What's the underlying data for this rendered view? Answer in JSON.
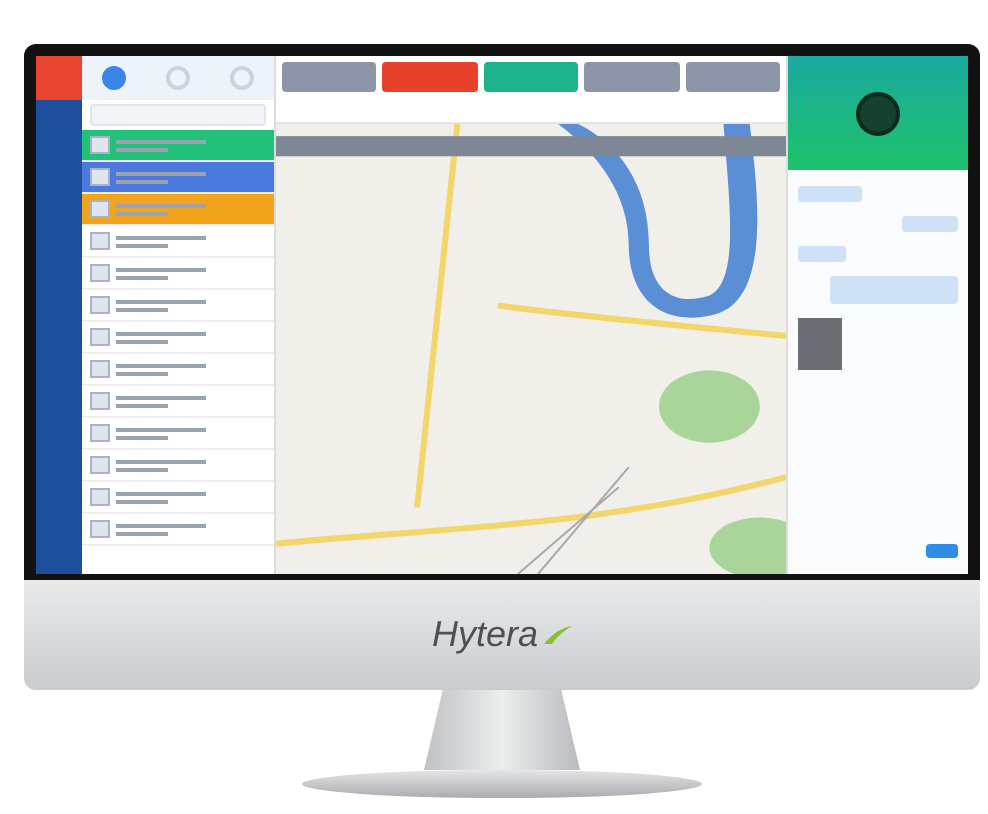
{
  "brand": {
    "name": "Hytera"
  },
  "contacts": [
    {
      "color": "#22c07a"
    },
    {
      "color": "#4a78dc"
    },
    {
      "color": "#f2a41c"
    },
    {
      "color": "#ffffff"
    },
    {
      "color": "#ffffff"
    },
    {
      "color": "#ffffff"
    },
    {
      "color": "#ffffff"
    },
    {
      "color": "#ffffff"
    },
    {
      "color": "#ffffff"
    },
    {
      "color": "#ffffff"
    },
    {
      "color": "#ffffff"
    },
    {
      "color": "#ffffff"
    },
    {
      "color": "#ffffff"
    }
  ],
  "cards": [
    {
      "color": "#8d96a8"
    },
    {
      "color": "#e5412b"
    },
    {
      "color": "#1fb38c"
    },
    {
      "color": "#8d96a8"
    },
    {
      "color": "#8d96a8"
    }
  ]
}
